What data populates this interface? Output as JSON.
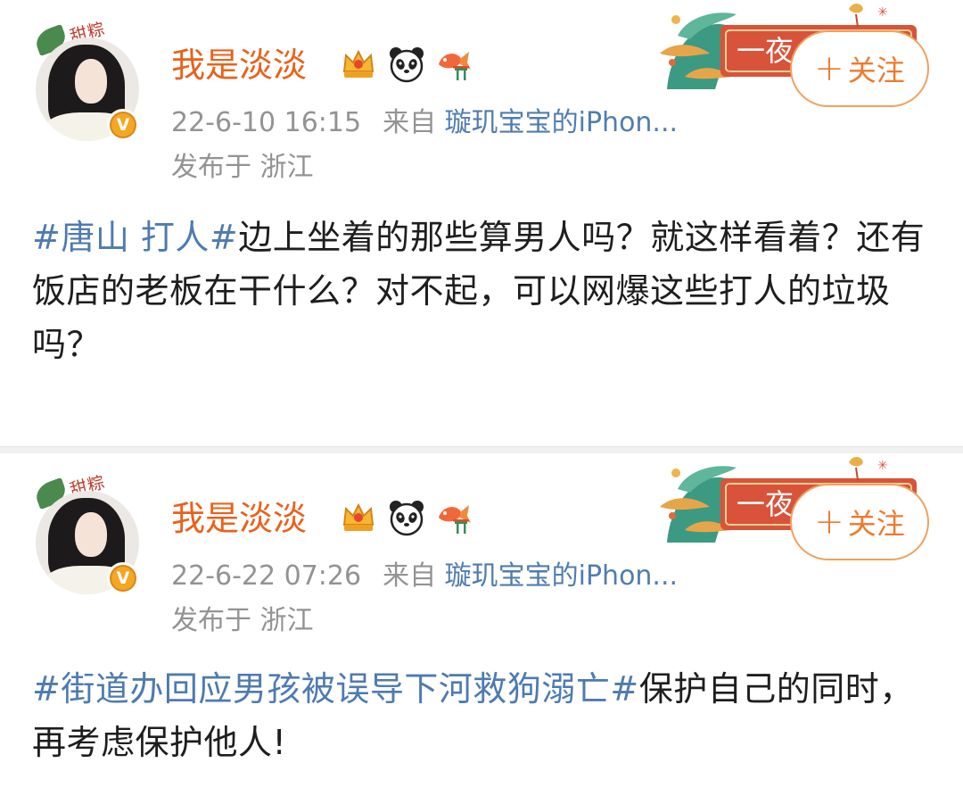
{
  "colors": {
    "username": "#e8621b",
    "topic_link": "#4e7bb0",
    "meta_text": "#939393",
    "follow_button": "#ee7a2c",
    "separator": "#f1f1f1"
  },
  "posts": [
    {
      "user": {
        "name": "我是淡淡",
        "avatar_frame_text": "甜粽",
        "badges": [
          "crown-badge-icon",
          "panda-badge-icon",
          "koi-badge-icon"
        ]
      },
      "time": "22-6-10 16:15",
      "from_label": "来自",
      "source": "璇玑宝宝的iPhon...",
      "location": "发布于 浙江",
      "follow": {
        "plus": "+",
        "label": "关注"
      },
      "decoration_text": "一夜",
      "topic": "#唐山 打人#",
      "text": "边上坐着的那些算男人吗？就这样看着？还有饭店的老板在干什么？对不起，可以网爆这些打人的垃圾吗？"
    },
    {
      "user": {
        "name": "我是淡淡",
        "avatar_frame_text": "甜粽",
        "badges": [
          "crown-badge-icon",
          "panda-badge-icon",
          "koi-badge-icon"
        ]
      },
      "time": "22-6-22 07:26",
      "from_label": "来自",
      "source": "璇玑宝宝的iPhon...",
      "location": "发布于 浙江",
      "follow": {
        "plus": "+",
        "label": "关注"
      },
      "decoration_text": "一夜",
      "topic": "#街道办回应男孩被误导下河救狗溺亡#",
      "text": "保护自己的同时，再考虑保护他人!"
    }
  ]
}
